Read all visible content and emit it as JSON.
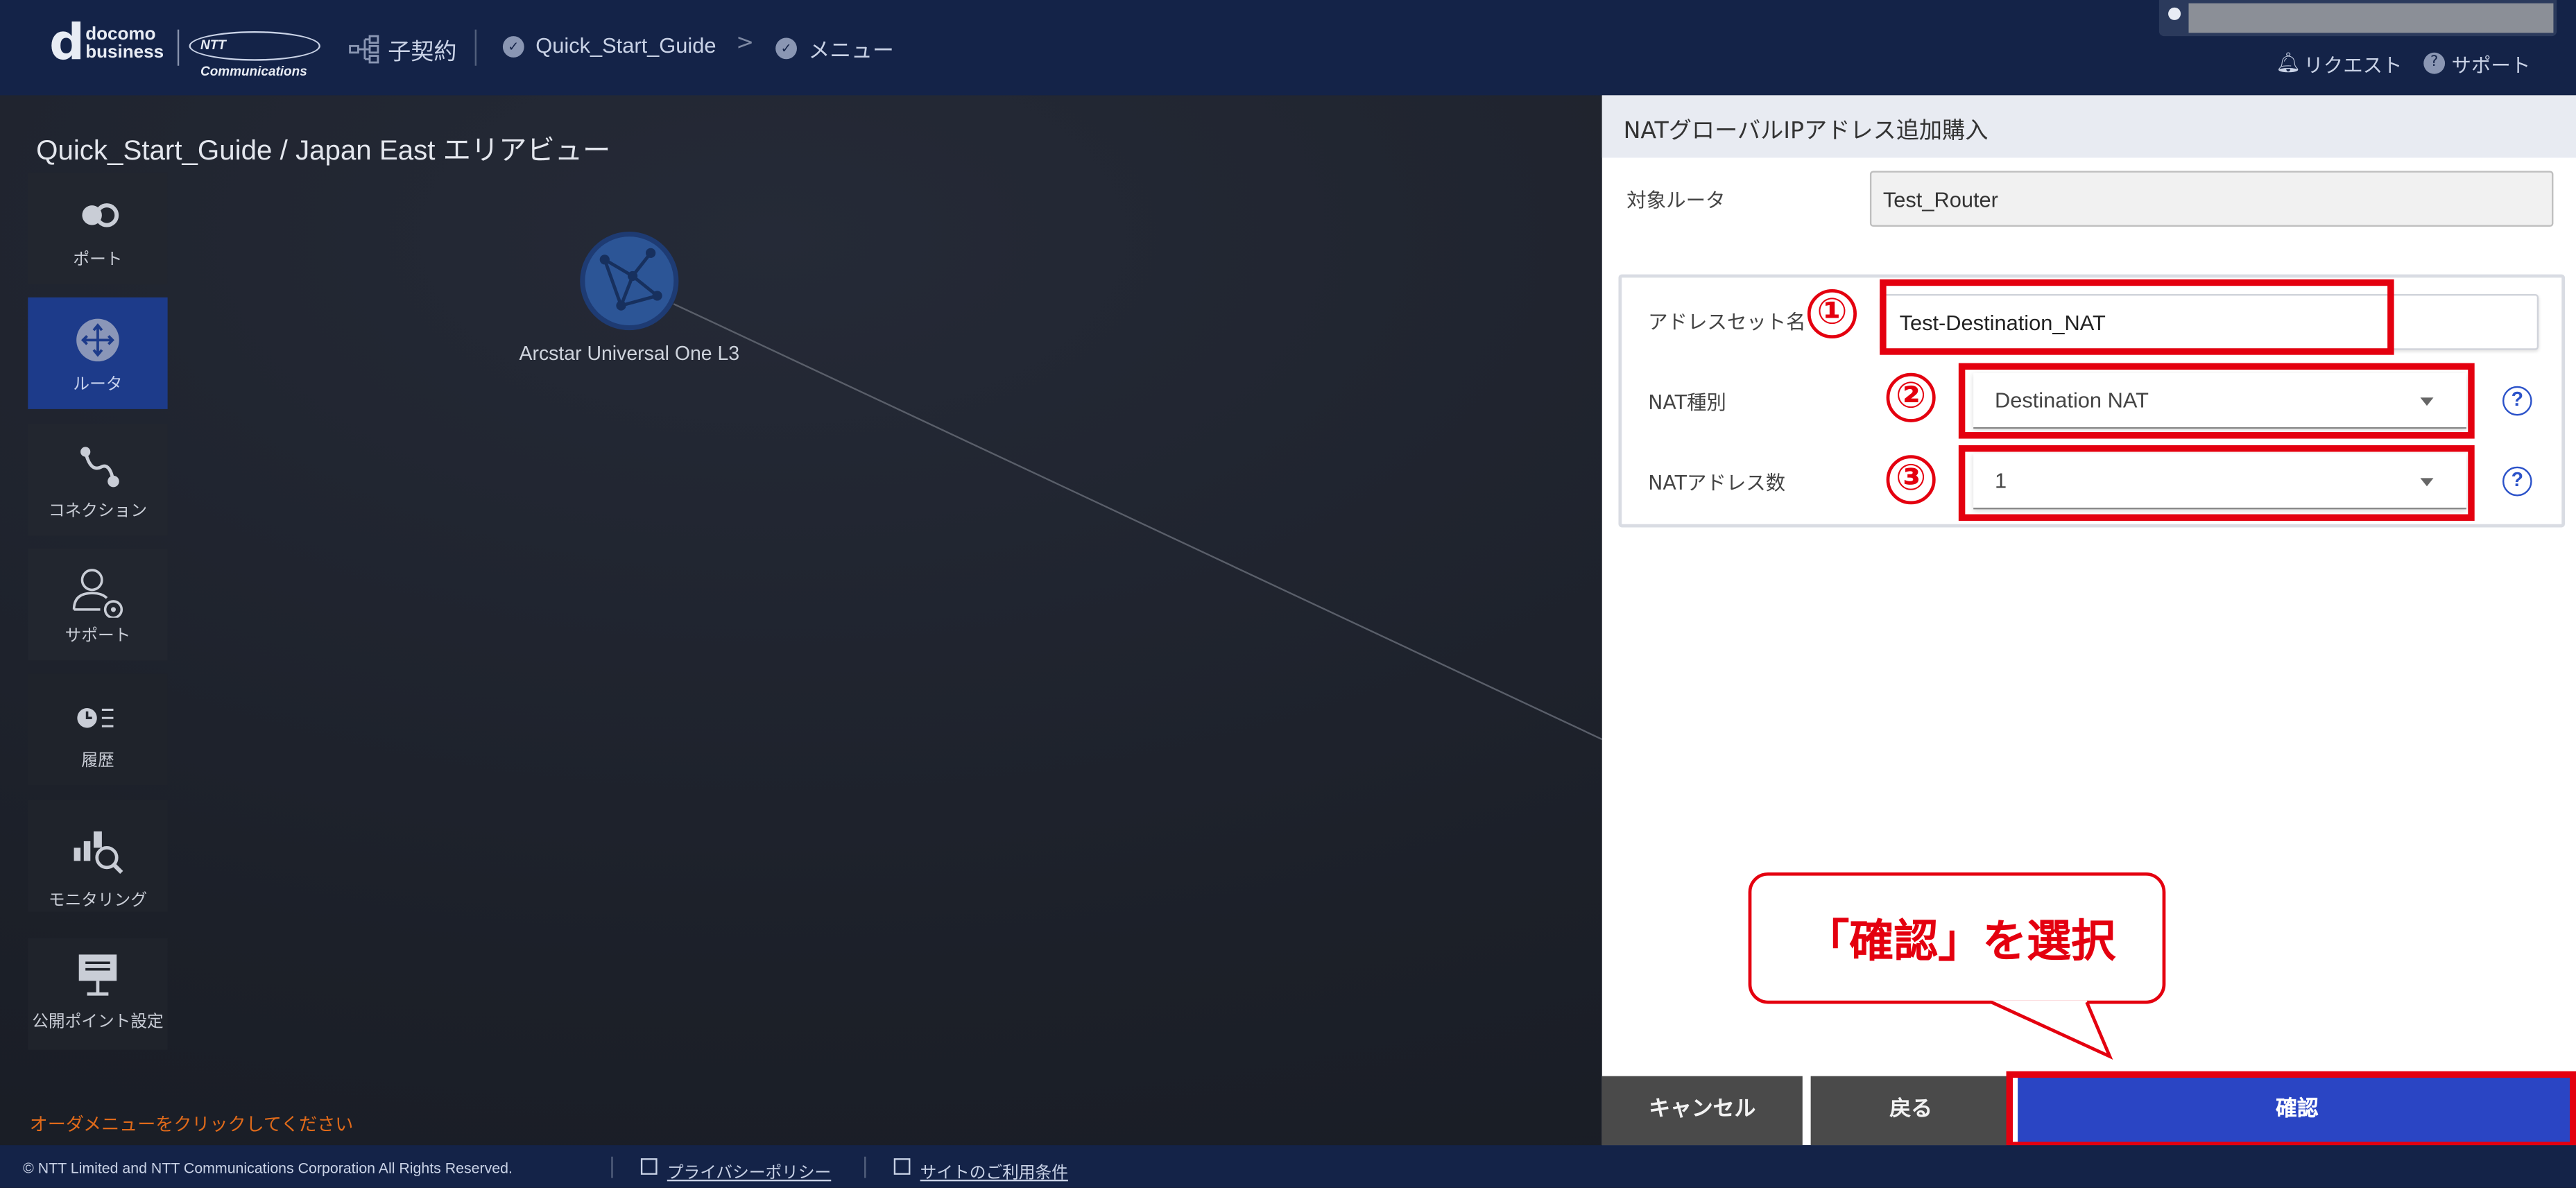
{
  "header": {
    "logo_d": "d",
    "logo_line1": "docomo",
    "logo_line2": "business",
    "ntt_logo": "NTT Communications",
    "contract_label": "子契約",
    "breadcrumb": [
      "Quick_Start_Guide",
      "メニュー"
    ],
    "breadcrumb_separator": ">",
    "request_link": "リクエスト",
    "support_link": "サポート"
  },
  "area_title": "Quick_Start_Guide / Japan East エリアビュー",
  "sidebar": {
    "items": [
      {
        "label": "ポート",
        "icon": "port-icon"
      },
      {
        "label": "ルータ",
        "icon": "router-icon",
        "active": true
      },
      {
        "label": "コネクション",
        "icon": "connection-icon"
      },
      {
        "label": "サポート",
        "icon": "support-user-icon"
      },
      {
        "label": "履歴",
        "icon": "history-icon"
      },
      {
        "label": "モニタリング",
        "icon": "monitoring-icon"
      },
      {
        "label": "公開ポイント設定",
        "icon": "public-point-icon"
      }
    ]
  },
  "canvas": {
    "node_label": "Arcstar Universal One L3",
    "order_hint": "オーダメニューをクリックしてください"
  },
  "panel": {
    "title": "NATグローバルIPアドレス追加購入",
    "target_router_label": "対象ルータ",
    "target_router_value": "Test_Router",
    "address_set_label": "アドレスセット名",
    "address_set_value": "Test-Destination_NAT",
    "nat_type_label": "NAT種別",
    "nat_type_value": "Destination NAT",
    "nat_count_label": "NATアドレス数",
    "nat_count_value": "1",
    "help_glyph": "?",
    "buttons": {
      "cancel": "キャンセル",
      "back": "戻る",
      "confirm": "確認"
    }
  },
  "annotations": {
    "step1": "①",
    "step2": "②",
    "step3": "③",
    "callout": "「確認」を選択",
    "color": "#e4000f"
  },
  "footer": {
    "copyright": "© NTT Limited and NTT Communications Corporation All Rights Reserved.",
    "privacy_link": "プライバシーポリシー",
    "terms_link": "サイトのご利用条件"
  }
}
